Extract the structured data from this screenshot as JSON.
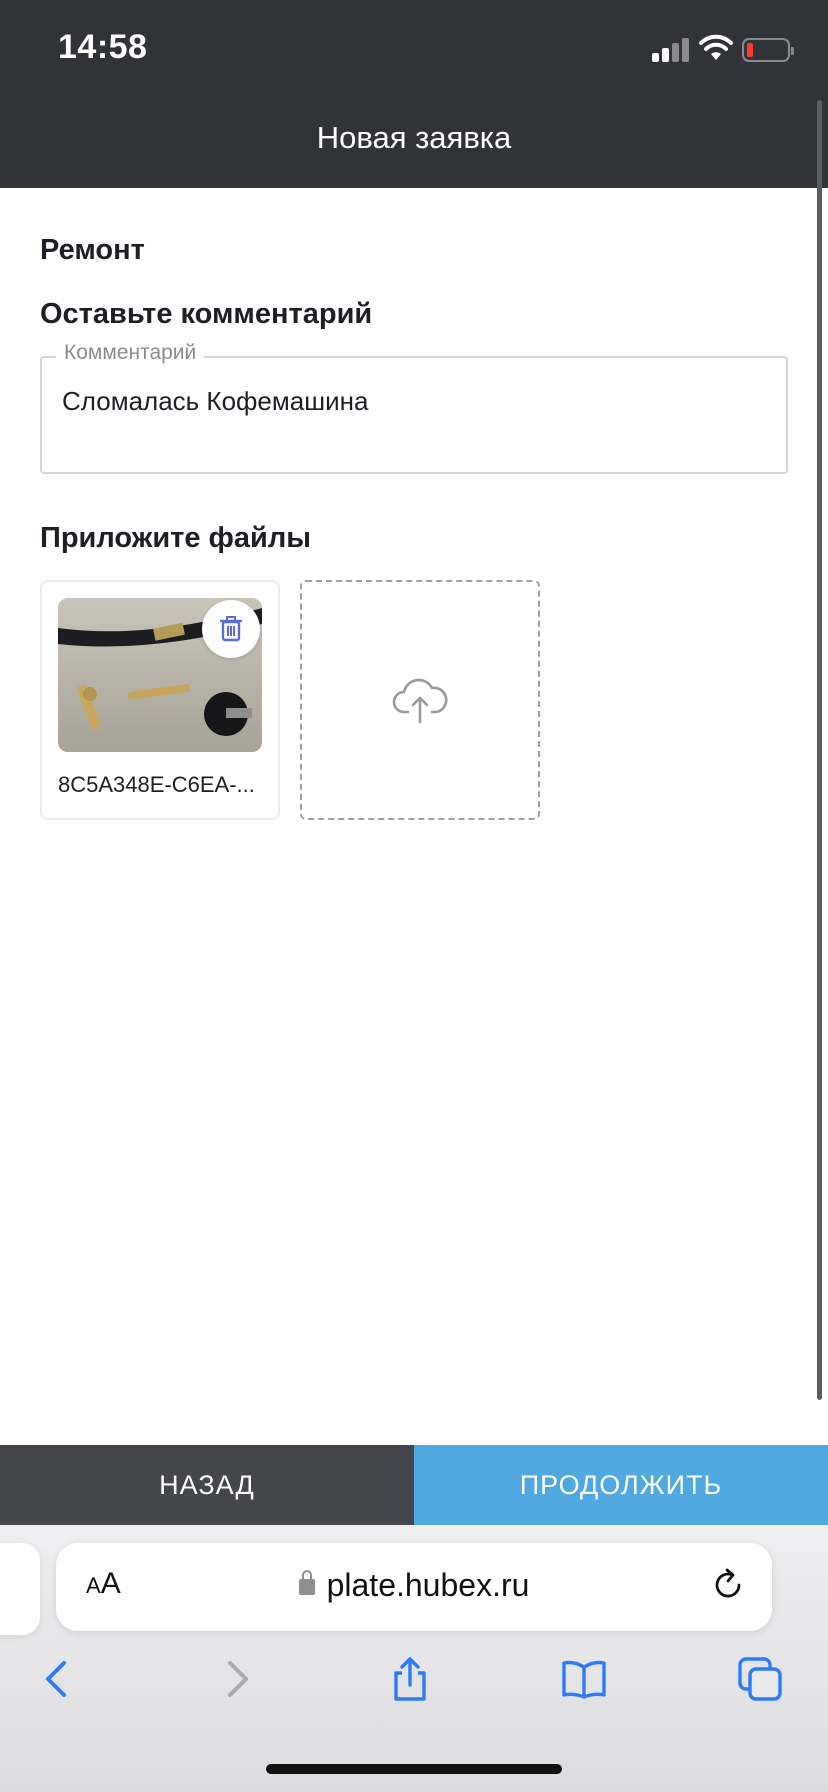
{
  "status_bar": {
    "time": "14:58",
    "battery_level": 0.1
  },
  "header": {
    "title": "Новая заявка"
  },
  "form": {
    "category": "Ремонт",
    "comment_heading": "Оставьте комментарий",
    "comment_label": "Комментарий",
    "comment_value": "Сломалась Кофемашина",
    "files_heading": "Приложите файлы",
    "files": [
      {
        "name": "8C5A348E-C6EA-..."
      }
    ]
  },
  "actions": {
    "back_label": "НАЗАД",
    "continue_label": "ПРОДОЛЖИТЬ"
  },
  "browser": {
    "text_size_label": "AA",
    "url": "plate.hubex.ru"
  },
  "icons": {
    "delete": "trash-icon",
    "upload": "cloud-upload-icon",
    "reload": "reload-icon",
    "back": "chevron-left-icon",
    "forward": "chevron-right-icon",
    "share": "share-icon",
    "bookmarks": "book-icon",
    "tabs": "tabs-icon"
  },
  "colors": {
    "header": "#323338",
    "back_button": "#45464b",
    "continue_button": "#4fa8e0",
    "accent": "#5b6bd6"
  }
}
